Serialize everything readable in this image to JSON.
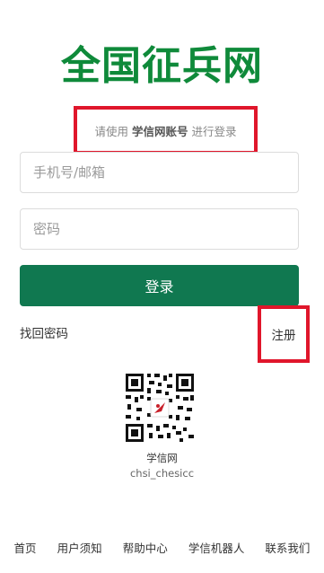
{
  "site_title": "全国征兵网",
  "login_hint": {
    "prefix": "请使用",
    "account": "学信网账号",
    "suffix": "进行登录"
  },
  "form": {
    "phone_placeholder": "手机号/邮箱",
    "password_placeholder": "密码",
    "login_label": "登录",
    "forgot_label": "找回密码",
    "register_label": "注册"
  },
  "qr": {
    "name": "学信网",
    "id": "chsi_chesicc"
  },
  "footer": [
    "首页",
    "用户须知",
    "帮助中心",
    "学信机器人",
    "联系我们"
  ],
  "colors": {
    "brand_green": "#0f8a3a",
    "button_green": "#107850",
    "highlight_red": "#e0162b"
  }
}
